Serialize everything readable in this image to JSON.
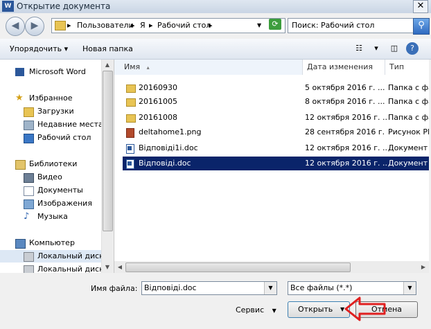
{
  "window": {
    "title": "Открытие документа",
    "app_icon_text": "W",
    "close_glyph": "✕"
  },
  "address": {
    "crumbs": [
      "Пользователи",
      "Я",
      "Рабочий стол"
    ],
    "separator": "▸",
    "search_value": "Поиск: Рабочий стол"
  },
  "toolbar": {
    "organize": "Упорядочить",
    "new_folder": "Новая папка",
    "dropdown": "▾"
  },
  "nav": {
    "items": [
      {
        "label": "Microsoft Word",
        "icon": "word-icon"
      },
      {
        "label": "Избранное",
        "icon": "star-icon"
      },
      {
        "label": "Загрузки",
        "icon": "downloads-icon"
      },
      {
        "label": "Недавние места",
        "icon": "recent-places-icon"
      },
      {
        "label": "Рабочий стол",
        "icon": "desktop-icon"
      },
      {
        "label": "Библиотеки",
        "icon": "libraries-icon"
      },
      {
        "label": "Видео",
        "icon": "video-icon"
      },
      {
        "label": "Документы",
        "icon": "documents-icon"
      },
      {
        "label": "Изображения",
        "icon": "images-icon"
      },
      {
        "label": "Музыка",
        "icon": "music-icon"
      },
      {
        "label": "Компьютер",
        "icon": "computer-icon"
      },
      {
        "label": "Локальный диск (",
        "icon": "drive-icon"
      },
      {
        "label": "Локальный диск (",
        "icon": "drive-icon"
      }
    ]
  },
  "columns": {
    "name": "Имя",
    "date": "Дата изменения",
    "type": "Тип"
  },
  "files": [
    {
      "name": "20160930",
      "date": "5 октября 2016 г. ...",
      "type": "Папка с фай",
      "icon": "folder-icon"
    },
    {
      "name": "20161005",
      "date": "8 октября 2016 г. ...",
      "type": "Папка с фай",
      "icon": "folder-icon"
    },
    {
      "name": "20161008",
      "date": "12 октября 2016 г. ...",
      "type": "Папка с фай",
      "icon": "folder-icon"
    },
    {
      "name": "deltahome1.png",
      "date": "28 сентября 2016 г. ...",
      "type": "Рисунок PNG",
      "icon": "png-icon"
    },
    {
      "name": "Відповіді1і.doc",
      "date": "12 октября 2016 г. ...",
      "type": "Документ М",
      "icon": "doc-icon"
    },
    {
      "name": "Відповіді.doc",
      "date": "12 октября 2016 г. ...",
      "type": "Документ М",
      "icon": "doc-icon",
      "selected": true
    }
  ],
  "bottom": {
    "filename_label": "Имя файла:",
    "filename_value": "Відповіді.doc",
    "filter_value": "Все файлы (*.*)",
    "service_label": "Сервис",
    "open_label": "Открыть",
    "cancel_label": "Отмена"
  },
  "colors": {
    "selection": "#0a246a",
    "accent_arrow": "#e02020"
  }
}
